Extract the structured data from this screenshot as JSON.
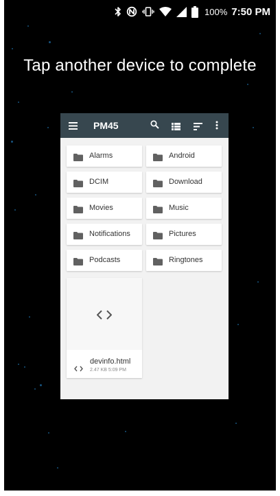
{
  "status_bar": {
    "battery_percent": "100%",
    "time": "7:50 PM",
    "icons": [
      "bluetooth-icon",
      "nfc-icon",
      "vibrate-icon",
      "wifi-icon",
      "signal-icon",
      "battery-icon"
    ]
  },
  "prompt": "Tap another device to complete",
  "preview": {
    "toolbar": {
      "title": "PM45",
      "icons": [
        "menu-icon",
        "search-icon",
        "list-view-icon",
        "sort-icon",
        "more-vert-icon"
      ]
    },
    "folders": [
      {
        "label": "Alarms"
      },
      {
        "label": "Android"
      },
      {
        "label": "DCIM"
      },
      {
        "label": "Download"
      },
      {
        "label": "Movies"
      },
      {
        "label": "Music"
      },
      {
        "label": "Notifications"
      },
      {
        "label": "Pictures"
      },
      {
        "label": "Podcasts"
      },
      {
        "label": "Ringtones"
      }
    ],
    "file": {
      "name": "devinfo.html",
      "meta": "2.47 KB 5:09 PM"
    }
  },
  "colors": {
    "background": "#000000",
    "toolbar": "#37474f",
    "folder_icon": "#616161",
    "card": "#ffffff",
    "star": "#1f6fa8"
  }
}
